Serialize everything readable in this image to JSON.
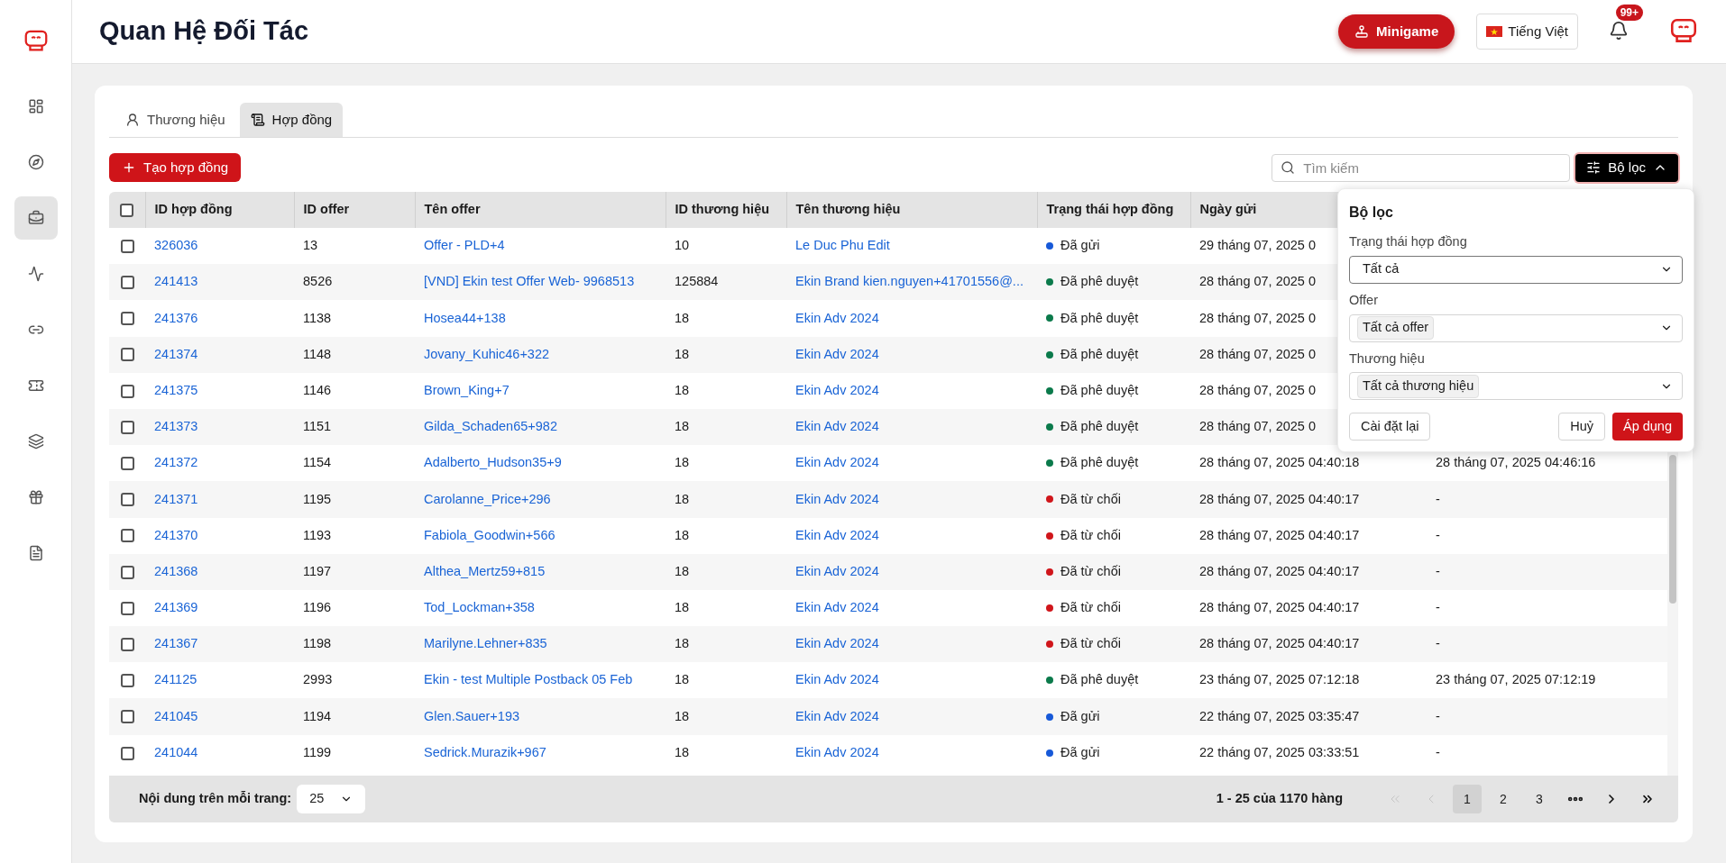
{
  "sidebar": {
    "items": [
      {
        "selected": false
      },
      {
        "selected": false
      },
      {
        "selected": true
      },
      {
        "selected": false
      },
      {
        "selected": false
      },
      {
        "selected": false
      },
      {
        "selected": false
      },
      {
        "selected": false
      },
      {
        "selected": false
      }
    ]
  },
  "header": {
    "title": "Quan Hệ Đối Tác",
    "minigame": "Minigame",
    "language": "Tiếng Việt",
    "notification_badge": "99+"
  },
  "tabs": [
    {
      "label": "Thương hiệu",
      "selected": false
    },
    {
      "label": "Hợp đồng",
      "selected": true
    }
  ],
  "create_button": "Tạo hợp đồng",
  "search": {
    "placeholder": "Tìm kiếm"
  },
  "filter_button": {
    "label": "Bộ lọc",
    "expanded": true
  },
  "table": {
    "select_all_checked": false,
    "columns": [
      "ID hợp đồng",
      "ID offer",
      "Tên offer",
      "ID thương hiệu",
      "Tên thương hiệu",
      "Trạng thái hợp đồng",
      "Ngày gửi"
    ],
    "rows": [
      {
        "checked": false,
        "id": "326036",
        "offer_id": "13",
        "offer_name": "Offer - PLD+4",
        "brand_id": "10",
        "brand_name": "Le Duc Phu Edit",
        "status": "Đã gửi",
        "color": "#1759d8",
        "sent": "29 tháng 07, 2025 0"
      },
      {
        "checked": false,
        "id": "241413",
        "offer_id": "8526",
        "offer_name": "[VND] Ekin test Offer Web- 9968513",
        "brand_id": "125884",
        "brand_name": "Ekin Brand kien.nguyen+41701556@...",
        "status": "Đã phê duyệt",
        "color": "#0b7a4b",
        "sent": "28 tháng 07, 2025 0"
      },
      {
        "checked": false,
        "id": "241376",
        "offer_id": "1138",
        "offer_name": "Hosea44+138",
        "brand_id": "18",
        "brand_name": "Ekin Adv 2024",
        "status": "Đã phê duyệt",
        "color": "#0b7a4b",
        "sent": "28 tháng 07, 2025 0"
      },
      {
        "checked": false,
        "id": "241374",
        "offer_id": "1148",
        "offer_name": "Jovany_Kuhic46+322",
        "brand_id": "18",
        "brand_name": "Ekin Adv 2024",
        "status": "Đã phê duyệt",
        "color": "#0b7a4b",
        "sent": "28 tháng 07, 2025 0"
      },
      {
        "checked": false,
        "id": "241375",
        "offer_id": "1146",
        "offer_name": "Brown_King+7",
        "brand_id": "18",
        "brand_name": "Ekin Adv 2024",
        "status": "Đã phê duyệt",
        "color": "#0b7a4b",
        "sent": "28 tháng 07, 2025 0"
      },
      {
        "checked": false,
        "id": "241373",
        "offer_id": "1151",
        "offer_name": "Gilda_Schaden65+982",
        "brand_id": "18",
        "brand_name": "Ekin Adv 2024",
        "status": "Đã phê duyệt",
        "color": "#0b7a4b",
        "sent": "28 tháng 07, 2025 0"
      },
      {
        "checked": false,
        "id": "241372",
        "offer_id": "1154",
        "offer_name": "Adalberto_Hudson35+9",
        "brand_id": "18",
        "brand_name": "Ekin Adv 2024",
        "status": "Đã phê duyệt",
        "color": "#0b7a4b",
        "sent": "28 tháng 07, 2025 04:40:18",
        "column_8": "28 tháng 07, 2025 04:46:16"
      },
      {
        "checked": false,
        "id": "241371",
        "offer_id": "1195",
        "offer_name": "Carolanne_Price+296",
        "brand_id": "18",
        "brand_name": "Ekin Adv 2024",
        "status": "Đã từ chối",
        "color": "#d0161b",
        "sent": "28 tháng 07, 2025 04:40:17",
        "column_8": "-"
      },
      {
        "checked": false,
        "id": "241370",
        "offer_id": "1193",
        "offer_name": "Fabiola_Goodwin+566",
        "brand_id": "18",
        "brand_name": "Ekin Adv 2024",
        "status": "Đã từ chối",
        "color": "#d0161b",
        "sent": "28 tháng 07, 2025 04:40:17",
        "column_8": "-"
      },
      {
        "checked": false,
        "id": "241368",
        "offer_id": "1197",
        "offer_name": "Althea_Mertz59+815",
        "brand_id": "18",
        "brand_name": "Ekin Adv 2024",
        "status": "Đã từ chối",
        "color": "#d0161b",
        "sent": "28 tháng 07, 2025 04:40:17",
        "column_8": "-"
      },
      {
        "checked": false,
        "id": "241369",
        "offer_id": "1196",
        "offer_name": "Tod_Lockman+358",
        "brand_id": "18",
        "brand_name": "Ekin Adv 2024",
        "status": "Đã từ chối",
        "color": "#d0161b",
        "sent": "28 tháng 07, 2025 04:40:17",
        "column_8": "-"
      },
      {
        "checked": false,
        "id": "241367",
        "offer_id": "1198",
        "offer_name": "Marilyne.Lehner+835",
        "brand_id": "18",
        "brand_name": "Ekin Adv 2024",
        "status": "Đã từ chối",
        "color": "#d0161b",
        "sent": "28 tháng 07, 2025 04:40:17",
        "column_8": "-"
      },
      {
        "checked": false,
        "id": "241125",
        "offer_id": "2993",
        "offer_name": "Ekin - test Multiple Postback 05 Feb",
        "brand_id": "18",
        "brand_name": "Ekin Adv 2024",
        "status": "Đã phê duyệt",
        "color": "#0b7a4b",
        "sent": "23 tháng 07, 2025 07:12:18",
        "column_8": "23 tháng 07, 2025 07:12:19"
      },
      {
        "checked": false,
        "id": "241045",
        "offer_id": "1194",
        "offer_name": "Glen.Sauer+193",
        "brand_id": "18",
        "brand_name": "Ekin Adv 2024",
        "status": "Đã gửi",
        "color": "#1759d8",
        "sent": "22 tháng 07, 2025 03:35:47",
        "column_8": "-"
      },
      {
        "checked": false,
        "id": "241044",
        "offer_id": "1199",
        "offer_name": "Sedrick.Murazik+967",
        "brand_id": "18",
        "brand_name": "Ekin Adv 2024",
        "status": "Đã gửi",
        "color": "#1759d8",
        "sent": "22 tháng 07, 2025 03:33:51",
        "column_8": "-"
      }
    ]
  },
  "footer": {
    "per_page_label": "Nội dung trên mỗi trang:",
    "per_page_value": "25",
    "range": "1 - 25 của 1170 hàng",
    "nav": [
      {
        "kind": "first",
        "disabled": true
      },
      {
        "kind": "prev",
        "disabled": true
      },
      {
        "kind": "next",
        "disabled": false
      },
      {
        "kind": "last",
        "disabled": false
      }
    ],
    "pages": [
      {
        "kind": "page",
        "label": "1",
        "selected": true
      },
      {
        "kind": "page",
        "label": "2",
        "selected": false
      },
      {
        "kind": "page",
        "label": "3",
        "selected": false
      },
      {
        "kind": "ellipsis"
      }
    ]
  },
  "filter_panel": {
    "title": "Bộ lọc",
    "fields": [
      {
        "label": "Trạng thái hợp đồng",
        "value": "Tất cả",
        "kind": "plain"
      },
      {
        "label": "Offer",
        "value": "Tất cả offer",
        "kind": "tag"
      },
      {
        "label": "Thương hiệu",
        "value": "Tất cả thương hiệu",
        "kind": "tag"
      }
    ],
    "reset": "Cài đặt lại",
    "cancel": "Huỷ",
    "apply": "Áp dụng"
  }
}
